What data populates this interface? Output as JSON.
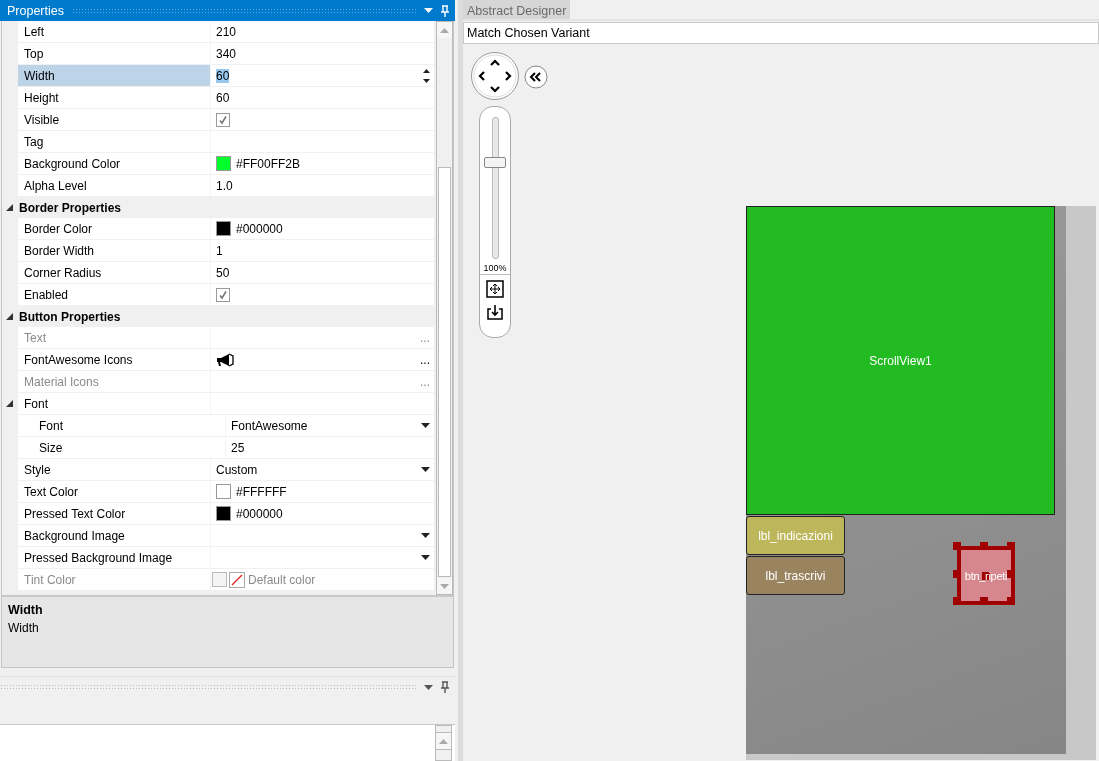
{
  "properties_panel": {
    "title": "Properties",
    "rows": [
      {
        "kind": "text",
        "name": "Left",
        "value": "210",
        "selected": false,
        "disabled": false
      },
      {
        "kind": "text",
        "name": "Top",
        "value": "340",
        "selected": false,
        "disabled": false
      },
      {
        "kind": "spin",
        "name": "Width",
        "value": "60",
        "selected": true,
        "disabled": false
      },
      {
        "kind": "text",
        "name": "Height",
        "value": "60",
        "selected": false,
        "disabled": false
      },
      {
        "kind": "check",
        "name": "Visible",
        "checked": true,
        "selected": false,
        "disabled": false
      },
      {
        "kind": "text",
        "name": "Tag",
        "selected": false,
        "disabled": false
      },
      {
        "kind": "color",
        "name": "Background Color",
        "color": "#00ff2b",
        "value": "#FF00FF2B",
        "selected": false,
        "disabled": false
      },
      {
        "kind": "text",
        "name": "Alpha Level",
        "value": "1.0",
        "selected": false,
        "disabled": false
      },
      {
        "kind": "category",
        "name": "Border Properties",
        "expanded": true,
        "children": [
          {
            "kind": "color",
            "name": "Border Color",
            "color": "#000000",
            "value": "#000000",
            "selected": false,
            "disabled": false
          },
          {
            "kind": "text",
            "name": "Border Width",
            "value": "1",
            "selected": false,
            "disabled": false
          },
          {
            "kind": "text",
            "name": "Corner Radius",
            "value": "50",
            "selected": false,
            "disabled": false
          },
          {
            "kind": "check",
            "name": "Enabled",
            "checked": true,
            "selected": false,
            "disabled": false
          }
        ]
      },
      {
        "kind": "category",
        "name": "Button Properties",
        "expanded": true,
        "children": [
          {
            "kind": "ellipsis",
            "name": "Text",
            "button": "...",
            "selected": false,
            "disabled": true
          },
          {
            "kind": "icon",
            "name": "FontAwesome Icons",
            "button": "...",
            "selected": false,
            "disabled": false
          },
          {
            "kind": "ellipsis",
            "name": "Material Icons",
            "button": "...",
            "selected": false,
            "disabled": true
          },
          {
            "kind": "group",
            "name": "Font",
            "expanded": true,
            "selected": false,
            "disabled": false,
            "children": [
              {
                "kind": "dropdown",
                "name": "Font",
                "value": "FontAwesome",
                "selected": false,
                "disabled": false
              },
              {
                "kind": "text",
                "name": "Size",
                "value": "25",
                "selected": false,
                "disabled": false
              }
            ]
          },
          {
            "kind": "dropdown",
            "name": "Style",
            "value": "Custom",
            "selected": false,
            "disabled": false
          },
          {
            "kind": "color",
            "name": "Text Color",
            "color": "#ffffff",
            "value": "#FFFFFF",
            "selected": false,
            "disabled": false
          },
          {
            "kind": "color",
            "name": "Pressed Text Color",
            "color": "#000000",
            "value": "#000000",
            "selected": false,
            "disabled": false
          },
          {
            "kind": "dropdown",
            "name": "Background Image",
            "selected": false,
            "disabled": false
          },
          {
            "kind": "dropdown",
            "name": "Pressed Background Image",
            "selected": false,
            "disabled": false
          },
          {
            "kind": "default-color",
            "name": "Tint Color",
            "value": "Default color",
            "selected": false,
            "disabled": true
          }
        ]
      }
    ],
    "description": {
      "title": "Width",
      "text": "Width"
    }
  },
  "designer": {
    "tab": "Abstract Designer",
    "variant": "Match Chosen Variant",
    "zoom": {
      "level": 0.68,
      "reading": "100%"
    },
    "widgets": [
      {
        "kind": "view",
        "text": "ScrollView1",
        "color": "#22bb22",
        "selected": false
      },
      {
        "kind": "label",
        "text": "lbl_indicazioni",
        "color": "#bdb65a",
        "selected": false
      },
      {
        "kind": "label",
        "text": "lbl_trascrivi",
        "color": "#9a8460",
        "selected": false
      },
      {
        "kind": "button",
        "text": "btn_ripeti",
        "color": "#d5878d",
        "selected": true
      }
    ]
  }
}
